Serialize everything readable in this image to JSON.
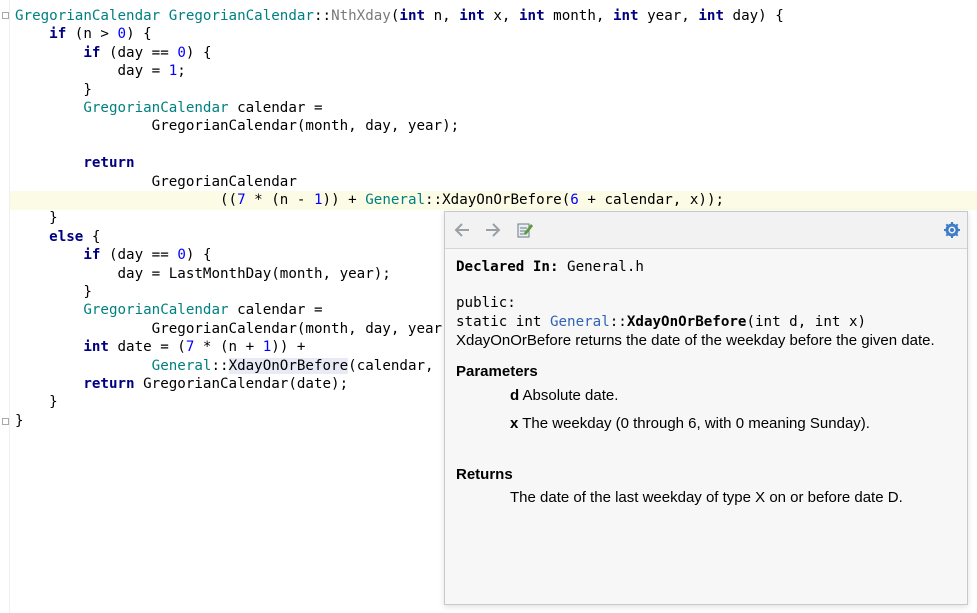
{
  "editor": {
    "code_lines": [
      {
        "segments": [
          {
            "t": "GregorianCalendar",
            "c": "ty"
          },
          {
            "t": " GregorianCalendar",
            "c": "ty"
          },
          {
            "t": "::",
            "c": "op"
          },
          {
            "t": "NthXday",
            "c": "fn"
          },
          {
            "t": "(",
            "c": "op"
          },
          {
            "t": "int",
            "c": "kw"
          },
          {
            "t": " n, ",
            "c": "op"
          },
          {
            "t": "int",
            "c": "kw"
          },
          {
            "t": " x, ",
            "c": "op"
          },
          {
            "t": "int",
            "c": "kw"
          },
          {
            "t": " month, ",
            "c": "op"
          },
          {
            "t": "int",
            "c": "kw"
          },
          {
            "t": " year, ",
            "c": "op"
          },
          {
            "t": "int",
            "c": "kw"
          },
          {
            "t": " day) {",
            "c": "op"
          }
        ]
      },
      {
        "segments": [
          {
            "t": "    ",
            "c": "op"
          },
          {
            "t": "if",
            "c": "kw"
          },
          {
            "t": " (n > ",
            "c": "op"
          },
          {
            "t": "0",
            "c": "num"
          },
          {
            "t": ") {",
            "c": "op"
          }
        ]
      },
      {
        "segments": [
          {
            "t": "        ",
            "c": "op"
          },
          {
            "t": "if",
            "c": "kw"
          },
          {
            "t": " (day == ",
            "c": "op"
          },
          {
            "t": "0",
            "c": "num"
          },
          {
            "t": ") {",
            "c": "op"
          }
        ]
      },
      {
        "segments": [
          {
            "t": "            day = ",
            "c": "op"
          },
          {
            "t": "1",
            "c": "num"
          },
          {
            "t": ";",
            "c": "op"
          }
        ]
      },
      {
        "segments": [
          {
            "t": "        }",
            "c": "op"
          }
        ]
      },
      {
        "segments": [
          {
            "t": "        ",
            "c": "op"
          },
          {
            "t": "GregorianCalendar",
            "c": "ty"
          },
          {
            "t": " calendar =",
            "c": "op"
          }
        ]
      },
      {
        "segments": [
          {
            "t": "                GregorianCalendar(month, day, year);",
            "c": "op"
          }
        ]
      },
      {
        "segments": [
          {
            "t": "",
            "c": "op"
          }
        ]
      },
      {
        "segments": [
          {
            "t": "        ",
            "c": "op"
          },
          {
            "t": "return",
            "c": "kw"
          }
        ]
      },
      {
        "segments": [
          {
            "t": "                GregorianCalendar",
            "c": "op"
          }
        ]
      },
      {
        "segments": [
          {
            "t": "                        ((",
            "c": "op"
          },
          {
            "t": "7",
            "c": "num"
          },
          {
            "t": " * (n - ",
            "c": "op"
          },
          {
            "t": "1",
            "c": "num"
          },
          {
            "t": ")) + ",
            "c": "op"
          },
          {
            "t": "General",
            "c": "ns"
          },
          {
            "t": "::",
            "c": "op"
          },
          {
            "t": "XdayOnOrBefore",
            "c": "op"
          },
          {
            "t": "(",
            "c": "op"
          },
          {
            "t": "6",
            "c": "num"
          },
          {
            "t": " + calendar, x));",
            "c": "op"
          }
        ]
      },
      {
        "segments": [
          {
            "t": "    }",
            "c": "op"
          }
        ]
      },
      {
        "segments": [
          {
            "t": "    ",
            "c": "op"
          },
          {
            "t": "else",
            "c": "kw"
          },
          {
            "t": " {",
            "c": "op"
          }
        ]
      },
      {
        "segments": [
          {
            "t": "        ",
            "c": "op"
          },
          {
            "t": "if",
            "c": "kw"
          },
          {
            "t": " (day == ",
            "c": "op"
          },
          {
            "t": "0",
            "c": "num"
          },
          {
            "t": ") {",
            "c": "op"
          }
        ]
      },
      {
        "segments": [
          {
            "t": "            day = LastMonthDay(month, year);",
            "c": "op"
          }
        ]
      },
      {
        "segments": [
          {
            "t": "        }",
            "c": "op"
          }
        ]
      },
      {
        "segments": [
          {
            "t": "        ",
            "c": "op"
          },
          {
            "t": "GregorianCalendar",
            "c": "ty"
          },
          {
            "t": " calendar =",
            "c": "op"
          }
        ]
      },
      {
        "segments": [
          {
            "t": "                GregorianCalendar(month, day, year",
            "c": "op"
          }
        ]
      },
      {
        "segments": [
          {
            "t": "        ",
            "c": "op"
          },
          {
            "t": "int",
            "c": "kw"
          },
          {
            "t": " date = (",
            "c": "op"
          },
          {
            "t": "7",
            "c": "num"
          },
          {
            "t": " * (n + ",
            "c": "op"
          },
          {
            "t": "1",
            "c": "num"
          },
          {
            "t": ")) +",
            "c": "op"
          }
        ]
      },
      {
        "segments": [
          {
            "t": "                ",
            "c": "op"
          },
          {
            "t": "General",
            "c": "ns"
          },
          {
            "t": "::",
            "c": "op"
          },
          {
            "t": "XdayOnOrBefore",
            "c": "op ident-hl"
          },
          {
            "t": "(calendar,",
            "c": "op"
          }
        ]
      },
      {
        "segments": [
          {
            "t": "        ",
            "c": "op"
          },
          {
            "t": "return",
            "c": "kw"
          },
          {
            "t": " GregorianCalendar(date);",
            "c": "op"
          }
        ]
      },
      {
        "segments": [
          {
            "t": "    }",
            "c": "op"
          }
        ]
      },
      {
        "segments": [
          {
            "t": "}",
            "c": "op"
          }
        ]
      }
    ]
  },
  "doc_popup": {
    "toolbar": {
      "back_icon": "arrow-left-icon",
      "forward_icon": "arrow-right-icon",
      "edit_source_icon": "edit-source-icon",
      "settings_icon": "gear-icon"
    },
    "declared_label": "Declared In:",
    "declared_file": "General.h",
    "access": "public:",
    "signature_prefix": "static int ",
    "signature_namespace": "General",
    "signature_sep": "::",
    "signature_name": "XdayOnOrBefore",
    "signature_params": "(int d, int x)",
    "summary": "XdayOnOrBefore returns the date of the weekday before the given date.",
    "parameters_title": "Parameters",
    "parameters": [
      {
        "name": "d",
        "desc": " Absolute date."
      },
      {
        "name": "x",
        "desc": " The weekday (0 through 6, with 0 meaning Sunday)."
      }
    ],
    "returns_title": "Returns",
    "returns_text": "The date of the last weekday of type X on or before date D."
  }
}
